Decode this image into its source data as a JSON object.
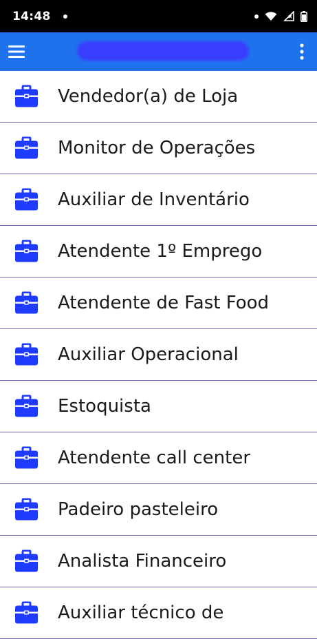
{
  "status_bar": {
    "time": "14:48"
  },
  "app_bar": {
    "menu_icon": "hamburger-menu-icon",
    "more_icon": "more-vert-icon",
    "title_redacted": true
  },
  "colors": {
    "app_bar": "#1f72ee",
    "icon_accent": "#1f3bff",
    "divider": "#6a6ab8"
  },
  "jobs": [
    {
      "label": "Vendedor(a) de Loja"
    },
    {
      "label": "Monitor de Operações"
    },
    {
      "label": "Auxiliar de Inventário"
    },
    {
      "label": "Atendente 1º Emprego"
    },
    {
      "label": "Atendente de Fast Food"
    },
    {
      "label": "Auxiliar Operacional"
    },
    {
      "label": "Estoquista"
    },
    {
      "label": "Atendente call center"
    },
    {
      "label": "Padeiro pasteleiro"
    },
    {
      "label": "Analista Financeiro"
    },
    {
      "label": "Auxiliar técnico de"
    }
  ]
}
